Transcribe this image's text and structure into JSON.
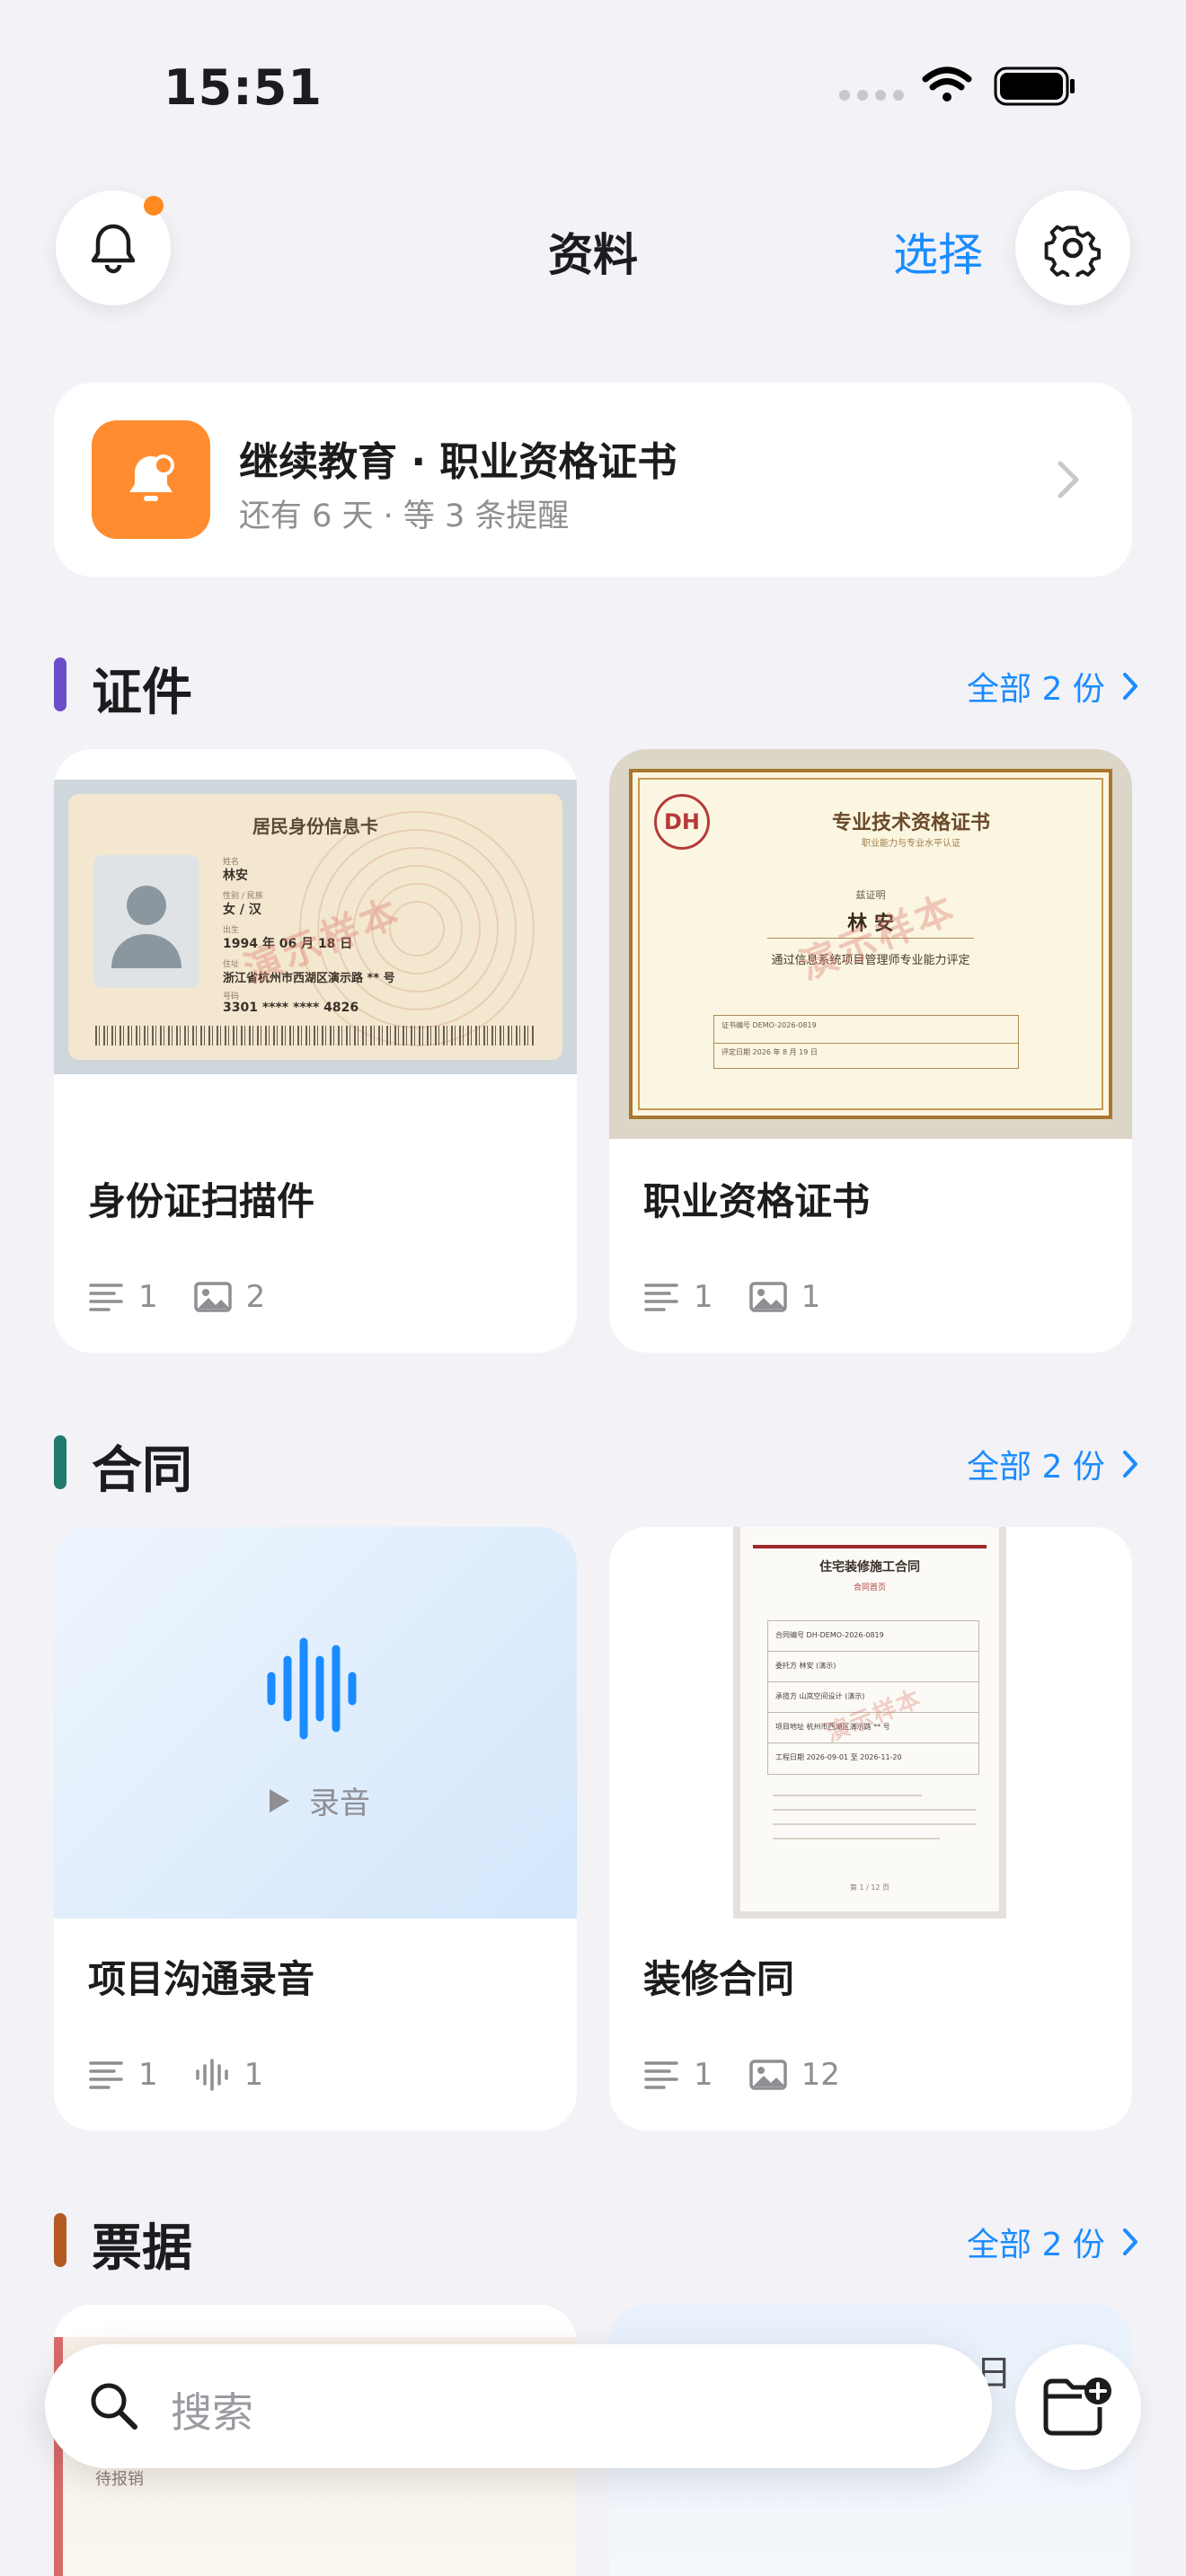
{
  "status": {
    "time": "15:51"
  },
  "header": {
    "title": "资料",
    "select_label": "选择"
  },
  "reminder": {
    "title": "继续教育 · 职业资格证书",
    "subtitle": "还有 6 天 · 等 3 条提醒"
  },
  "sections": [
    {
      "title": "证件",
      "accent": "#6b4fc8",
      "all_label": "全部 2 份",
      "cards": [
        {
          "title": "身份证扫描件",
          "text_count": "1",
          "image_count": "2",
          "thumb": {
            "card_title": "居民身份信息卡",
            "name_label": "姓名",
            "name": "林安",
            "sex_label": "性别 / 民族",
            "sex": "女 / 汉",
            "birth_label": "出生",
            "birth": "1994 年 06 月 18 日",
            "addr_label": "住址",
            "addr": "浙江省杭州市西湖区演示路 ** 号",
            "id_label": "号码",
            "id": "3301 **** **** 4826",
            "watermark": "演示样本"
          }
        },
        {
          "title": "职业资格证书",
          "text_count": "1",
          "image_count": "1",
          "thumb": {
            "logo": "DH",
            "cert_title": "专业技术资格证书",
            "cert_sub": "职业能力与专业水平认证",
            "holder_label": "兹证明",
            "holder": "林 安",
            "desc": "通过信息系统项目管理师专业能力评定",
            "no": "证书编号 DEMO-2026-0819",
            "date": "评定日期 2026 年 8 月 19 日",
            "watermark": "演示样本"
          }
        }
      ]
    },
    {
      "title": "合同",
      "accent": "#1f7a6c",
      "all_label": "全部 2 份",
      "cards": [
        {
          "title": "项目沟通录音",
          "text_count": "1",
          "audio_count": "1",
          "thumb": {
            "label": "录音"
          }
        },
        {
          "title": "装修合同",
          "text_count": "1",
          "image_count": "12",
          "thumb": {
            "doc_title": "住宅装修施工合同",
            "doc_sub": "合同首页",
            "rows": [
              "合同编号 DH-DEMO-2026-0819",
              "委托方 林安 (演示)",
              "承揽方 山岚空间设计 (演示)",
              "项目地址 杭州市西湖区演示路 ** 号",
              "工程日期 2026-09-01 至 2026-11-20"
            ],
            "page": "第 1 / 12 页",
            "watermark": "演示样本"
          }
        }
      ]
    },
    {
      "title": "票据",
      "accent": "#b35a22",
      "all_label": "全部 2 份",
      "cards": [
        {
          "peek_text": "待报销"
        },
        {
          "peek_text": "日"
        }
      ]
    }
  ],
  "search": {
    "placeholder": "搜索"
  }
}
